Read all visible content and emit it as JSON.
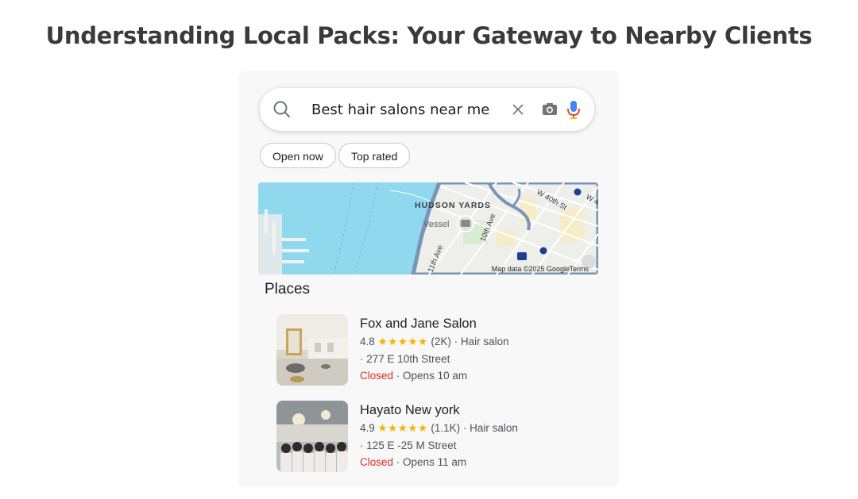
{
  "page_title": "Understanding Local Packs: Your Gateway to Nearby Clients",
  "search": {
    "query": "Best hair salons near me",
    "icons": [
      "search-icon",
      "close-icon",
      "camera-icon",
      "microphone-icon"
    ]
  },
  "filters": [
    "Open now",
    "Top rated"
  ],
  "map": {
    "labels": {
      "area": "HUDSON YARDS",
      "landmark": "Vessel",
      "street_1": "10th Ave",
      "street_2": "11th Ave",
      "street_3": "W 40th St",
      "street_4": "W 4"
    },
    "attribution": "Map data ©2025 Google",
    "terms": "Terms",
    "colors": {
      "water": "#8fd8ee",
      "land": "#eeeeea",
      "road": "#7a93b8"
    }
  },
  "places_heading": "Places",
  "places": [
    {
      "name": "Fox and Jane Salon",
      "rating": "4.8",
      "stars": "★★★★★",
      "reviews": "(2K)",
      "category": "· Hair salon",
      "address": "· 277 E 10th Street",
      "status": "Closed",
      "hours": "· Opens 10 am"
    },
    {
      "name": "Hayato New york",
      "rating": "4.9",
      "stars": "★★★★★",
      "reviews": "(1.1K)",
      "category": "· Hair salon",
      "address": "· 125  E -25 M Street",
      "status": "Closed",
      "hours": "· Opens 11 am"
    }
  ]
}
